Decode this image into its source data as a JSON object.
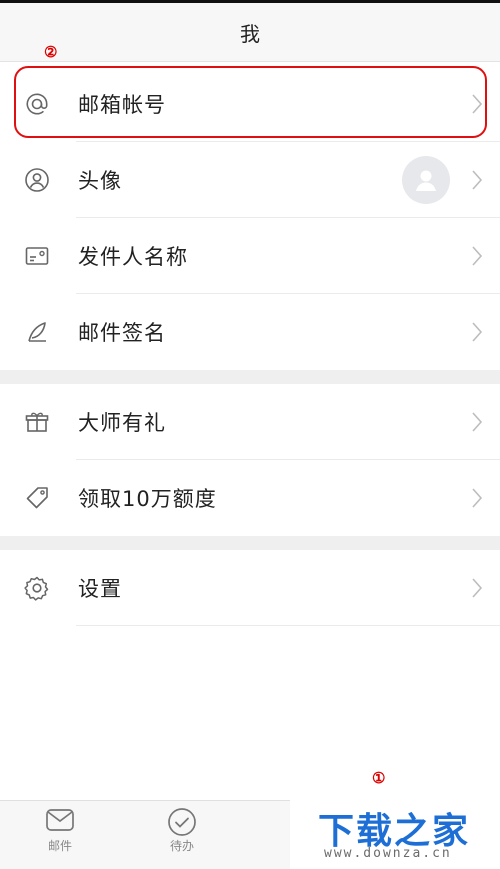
{
  "header": {
    "title": "我"
  },
  "markers": {
    "m1": "①",
    "m2": "②"
  },
  "sections": [
    {
      "items": [
        {
          "label": "邮箱帐号",
          "icon": "at-icon"
        },
        {
          "label": "头像",
          "icon": "user-circle-icon",
          "has_avatar": true
        },
        {
          "label": "发件人名称",
          "icon": "id-card-icon"
        },
        {
          "label": "邮件签名",
          "icon": "feather-icon"
        }
      ]
    },
    {
      "items": [
        {
          "label": "大师有礼",
          "icon": "gift-icon"
        },
        {
          "label": "领取10万额度",
          "icon": "tag-icon"
        }
      ]
    },
    {
      "items": [
        {
          "label": "设置",
          "icon": "gear-icon"
        }
      ]
    }
  ],
  "tabbar": {
    "tabs": [
      {
        "label": "邮件",
        "icon": "mail-icon"
      },
      {
        "label": "待办",
        "icon": "check-circle-icon"
      }
    ]
  },
  "watermark": {
    "title": "下载之家",
    "url": "www.downza.cn"
  },
  "colors": {
    "highlight": "#e01010",
    "watermark_blue": "#1d6fd6",
    "icon_gray": "#666666"
  }
}
